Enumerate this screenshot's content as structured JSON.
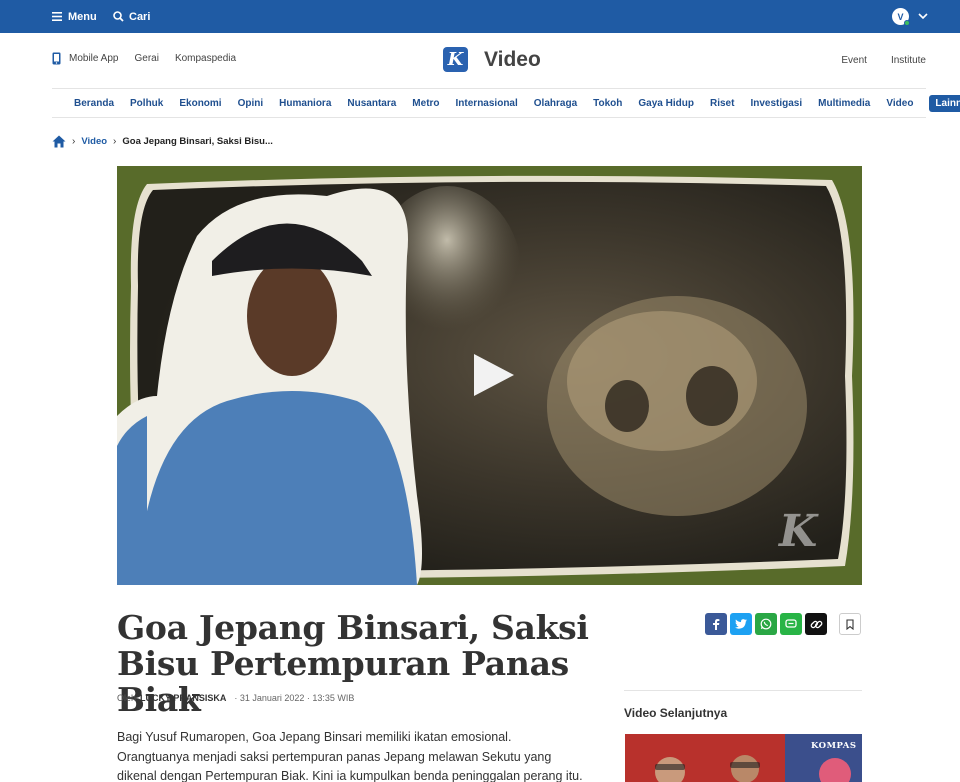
{
  "topbar": {
    "menu_label": "Menu",
    "search_label": "Cari",
    "avatar_initial": "V"
  },
  "subheader": {
    "left_links": [
      "Mobile App",
      "Gerai",
      "Kompaspedia"
    ],
    "logo_letter": "K",
    "section_title": "Video",
    "right_links": [
      "Event",
      "Institute"
    ]
  },
  "nav": {
    "items": [
      "Beranda",
      "Polhuk",
      "Ekonomi",
      "Opini",
      "Humaniora",
      "Nusantara",
      "Metro",
      "Internasional",
      "Olahraga",
      "Tokoh",
      "Gaya Hidup",
      "Riset",
      "Investigasi",
      "Multimedia",
      "Video"
    ],
    "more_label": "Lainnya"
  },
  "breadcrumb": {
    "section": "Video",
    "current": "Goa Jepang Binsari, Saksi Bisu..."
  },
  "video": {
    "watermark": "K"
  },
  "article": {
    "title": "Goa Jepang Binsari, Saksi Bisu Pertempuran Panas Biak",
    "byline_prefix": "Oleh",
    "author": "LUCKY PRANSISKA",
    "date": "· 31 Januari 2022 · 13:35 WIB",
    "body": "Bagi Yusuf Rumaropen, Goa Jepang Binsari memiliki ikatan emosional. Orangtuanya menjadi saksi pertempuran panas Jepang melawan Sekutu yang dikenal dengan Pertempuran Biak. Kini ia kumpulkan benda peninggalan perang itu."
  },
  "share": {
    "colors": {
      "facebook": "#3b5998",
      "twitter": "#1da1f2",
      "whatsapp": "#2aa745",
      "line": "#28b446",
      "copy": "#111111"
    }
  },
  "sidebar": {
    "title": "Video Selanjutnya",
    "thumb_label": "KOMPAS"
  },
  "colors": {
    "brand": "#1f5ba4",
    "nav_text": "#1f4f8f"
  }
}
